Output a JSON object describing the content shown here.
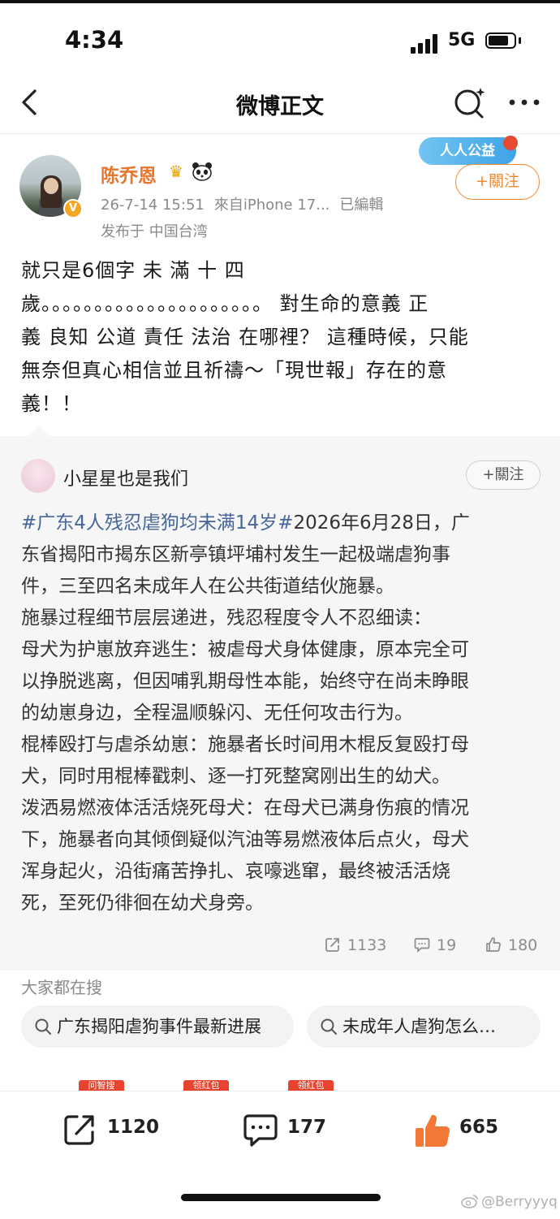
{
  "status_bar": {
    "time": "4:34",
    "network": "5G",
    "battery_level": 0.7
  },
  "nav": {
    "title": "微博正文"
  },
  "post": {
    "author": "陈乔恩",
    "badges": [
      "crown-icon",
      "panda-icon"
    ],
    "verified_badge": "V",
    "meta": {
      "time": "26-7-14 15:51",
      "source": "來自iPhone 17...",
      "edited": "已編輯"
    },
    "location": "发布于 中国台湾",
    "charity_badge": "人人公益",
    "follow_label": "+關注",
    "text_lines": [
      "就只是6個字 未 滿 十 四",
      "歲。。。。。。。。。。。。。。。。。。。。。  對生命的意義 正",
      "義 良知 公道 責任 法治  在哪裡？  這種時候，只能",
      "無奈但真心相信並且祈禱～「現世報」存在的意",
      "義！！"
    ]
  },
  "quoted_post": {
    "author": "小星星也是我们",
    "follow_label": "+關注",
    "hashtag": "#广东4人残忍虐狗均未满14岁#",
    "first_line_rest": "2026年6月28日，广",
    "text_lines": [
      "东省揭阳市揭东区新亭镇坪埔村发生一起极端虐狗事",
      "件，三至四名未成年人在公共街道结伙施暴。",
      "施暴过程细节层层递进，残忍程度令人不忍细读：",
      "母犬为护崽放弃逃生：被虐母犬身体健康，原本完全可",
      "以挣脱逃离，但因哺乳期母性本能，始终守在尚未睁眼",
      "的幼崽身边，全程温顺躲闪、无任何攻击行为。",
      "棍棒殴打与虐杀幼崽：施暴者长时间用木棍反复殴打母",
      "犬，同时用棍棒戳刺、逐一打死整窝刚出生的幼犬。",
      "泼洒易燃液体活活烧死母犬：在母犬已满身伤痕的情况",
      "下，施暴者向其倾倒疑似汽油等易燃液体后点火，母犬",
      "浑身起火，沿街痛苦挣扎、哀嚎逃窜，最终被活活烧",
      "死，至死仍徘徊在幼犬身旁。"
    ],
    "stats": {
      "reposts": "1133",
      "comments": "19",
      "likes": "180"
    }
  },
  "trending": {
    "heading": "大家都在搜",
    "chips": [
      "广东揭阳虐狗事件最新进展",
      "未成年人虐狗怎么…"
    ],
    "tags": [
      "问智搜",
      "领红包",
      "领红包"
    ]
  },
  "bottom_bar": {
    "reposts": "1120",
    "comments": "177",
    "likes": "665"
  },
  "watermark": "@Berryyyq",
  "colors": {
    "author": "#e8762d",
    "follow": "#f08a32",
    "hashtag": "#46669a",
    "like": "#f27835"
  }
}
